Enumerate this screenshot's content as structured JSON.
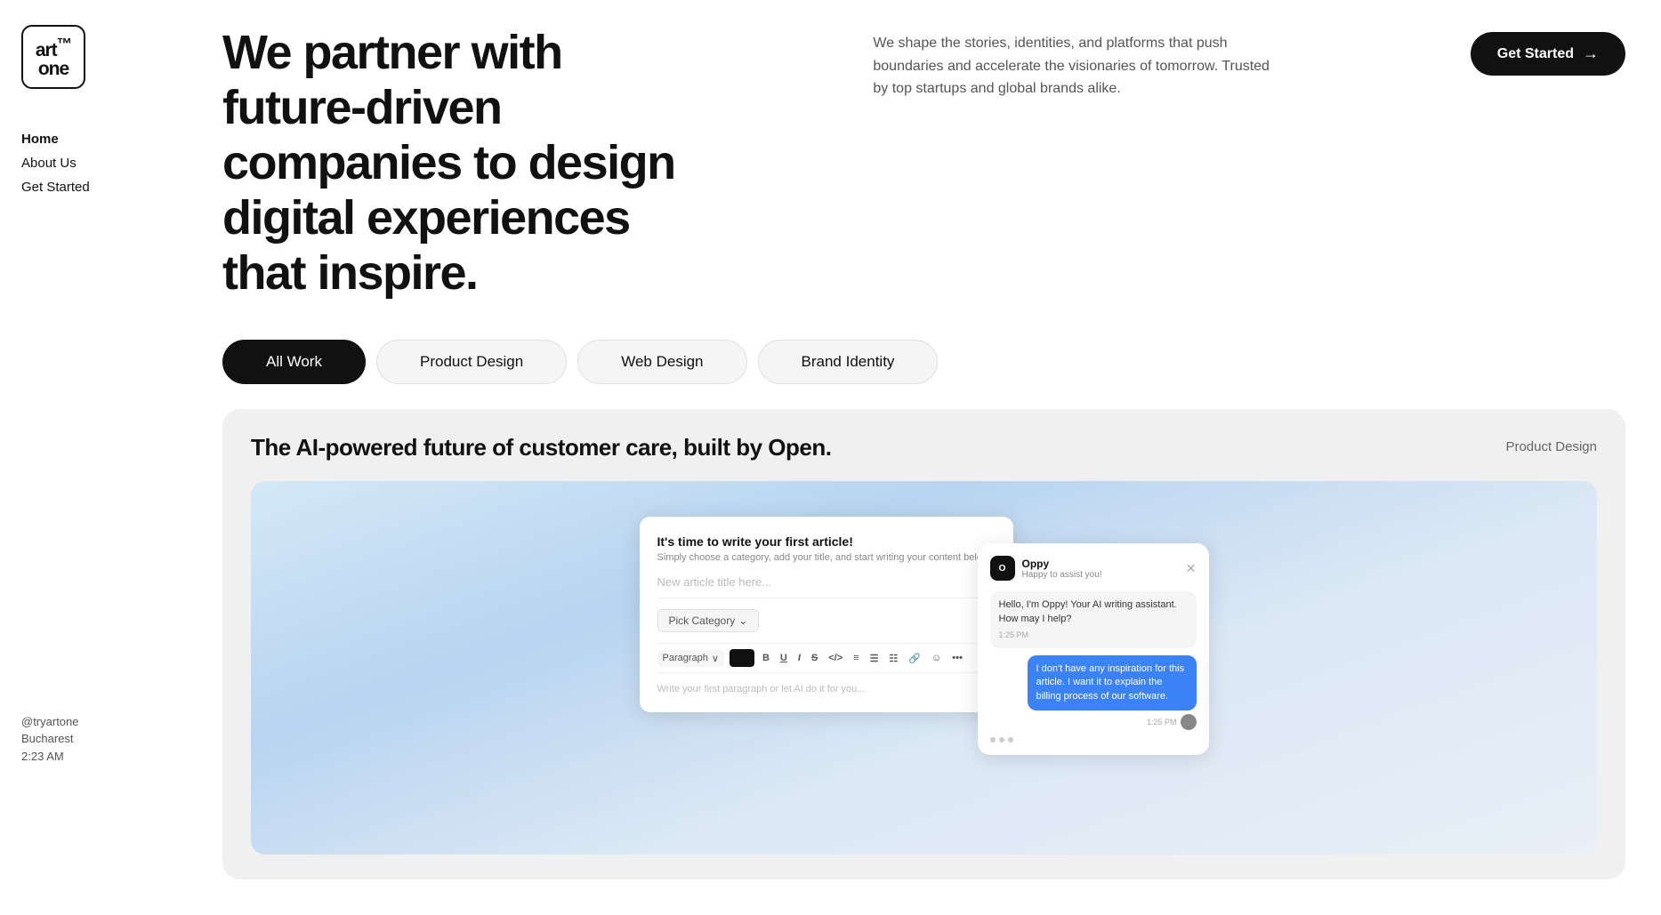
{
  "sidebar": {
    "logo_text": "art\none",
    "logo_tm": "™",
    "nav": [
      {
        "label": "Home",
        "active": true
      },
      {
        "label": "About Us",
        "active": false
      },
      {
        "label": "Get Started",
        "active": false
      }
    ],
    "footer": {
      "handle": "@tryartone",
      "city": "Bucharest",
      "time": "2:23 AM"
    }
  },
  "header": {
    "hero_title": "We partner with future-driven companies to design digital experiences that inspire.",
    "hero_desc": "We shape the stories, identities, and platforms that push boundaries and accelerate the visionaries of tomorrow. Trusted by top startups and global brands alike.",
    "cta_label": "Get Started",
    "cta_arrow": "→"
  },
  "tabs": [
    {
      "label": "All Work",
      "active": true
    },
    {
      "label": "Product Design",
      "active": false
    },
    {
      "label": "Web Design",
      "active": false
    },
    {
      "label": "Brand Identity",
      "active": false
    }
  ],
  "work_card": {
    "title": "The AI-powered future of customer care, built by Open.",
    "category": "Product Design"
  },
  "editor_mockup": {
    "header": "It's time to write your first article!",
    "sub": "Simply choose a category, add your title, and start writing your content below.",
    "title_placeholder": "New article title here...",
    "category_btn": "Pick Category",
    "toolbar_paragraph": "Paragraph",
    "body_placeholder": "Write your first paragraph or let AI do it for you..."
  },
  "chat_mockup": {
    "agent_name": "Oppy",
    "agent_status": "Happy to assist you!",
    "system_msg": "Hello, I'm Oppy! Your AI writing assistant. How may I help?",
    "system_time": "1:25 PM",
    "user_msg": "I don't have any inspiration for this article. I want it to explain the billing process of our software.",
    "user_time": "1:25 PM"
  }
}
